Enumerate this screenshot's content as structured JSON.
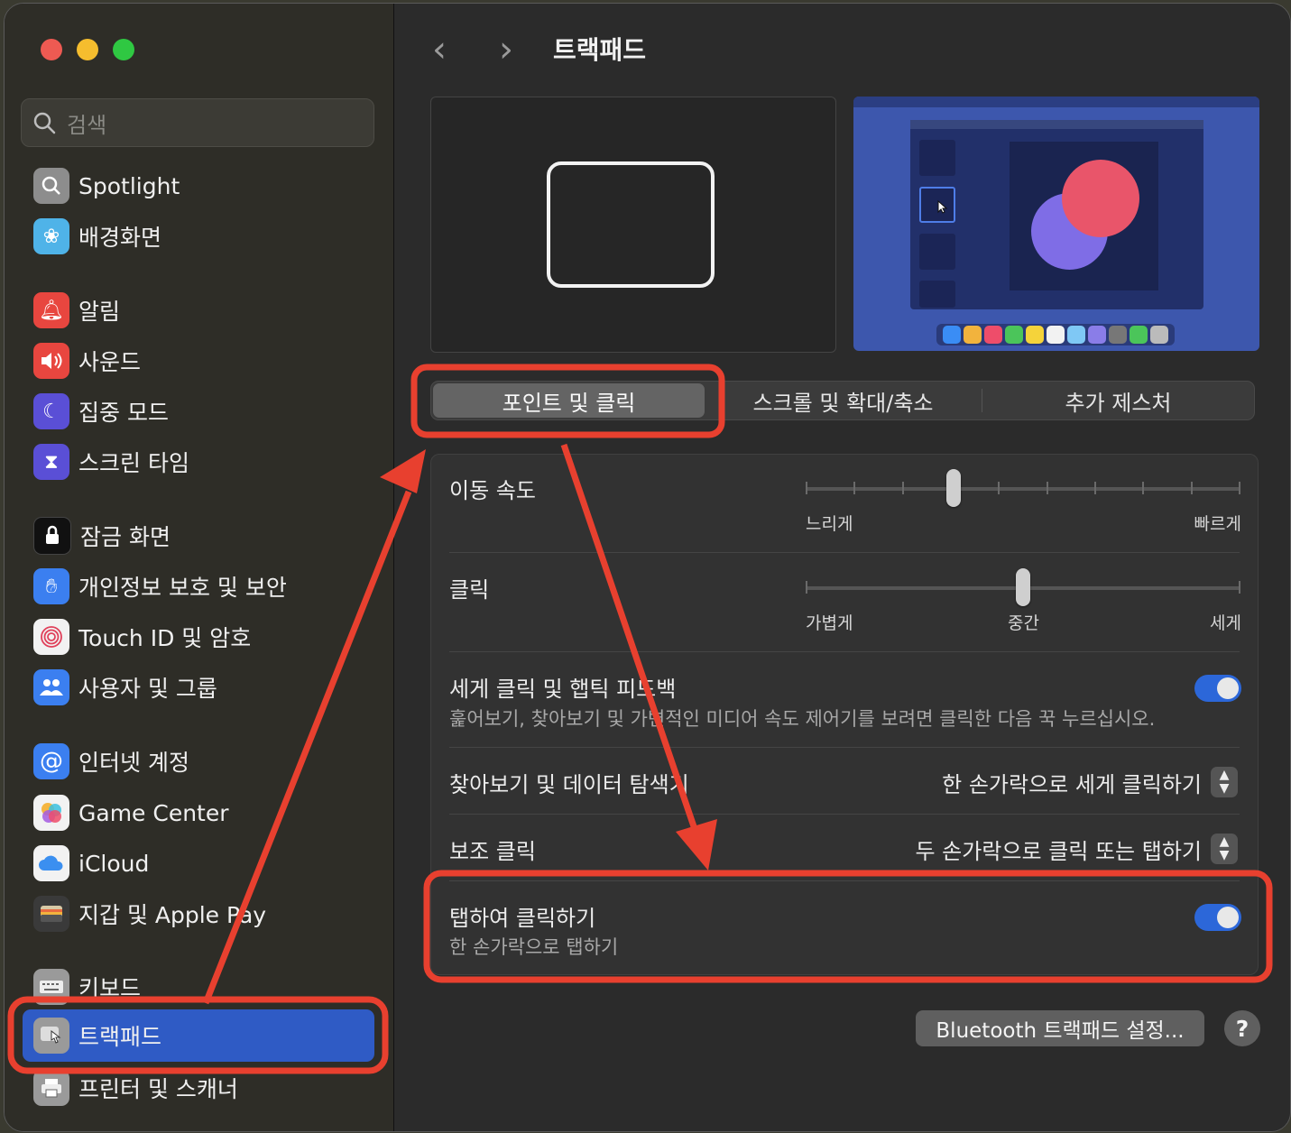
{
  "window": {
    "title": "트랙패드"
  },
  "search": {
    "placeholder": "검색"
  },
  "sidebar": {
    "items": [
      {
        "label": "Spotlight",
        "icon": "spotlight-icon",
        "color": "#8d8d8d"
      },
      {
        "label": "배경화면",
        "icon": "wallpaper-icon",
        "color": "#4fb3e8"
      },
      {
        "label": "알림",
        "icon": "bell-icon",
        "color": "#e8463f"
      },
      {
        "label": "사운드",
        "icon": "speaker-icon",
        "color": "#e8463f"
      },
      {
        "label": "집중 모드",
        "icon": "moon-icon",
        "color": "#5a4fd6"
      },
      {
        "label": "스크린 타임",
        "icon": "hourglass-icon",
        "color": "#5a4fd6"
      },
      {
        "label": "잠금 화면",
        "icon": "lock-icon",
        "color": "#1c1c1c"
      },
      {
        "label": "개인정보 보호 및 보안",
        "icon": "hand-icon",
        "color": "#3b7ff0"
      },
      {
        "label": "Touch ID 및 암호",
        "icon": "fingerprint-icon",
        "color": "#f2f2f2"
      },
      {
        "label": "사용자 및 그룹",
        "icon": "users-icon",
        "color": "#3b7ff0"
      },
      {
        "label": "인터넷 계정",
        "icon": "at-icon",
        "color": "#3b7ff0"
      },
      {
        "label": "Game Center",
        "icon": "game-center-icon",
        "color": "#f2f2f2"
      },
      {
        "label": "iCloud",
        "icon": "cloud-icon",
        "color": "#f2f2f2"
      },
      {
        "label": "지갑 및 Apple Pay",
        "icon": "wallet-icon",
        "color": "#3a3a3a"
      },
      {
        "label": "키보드",
        "icon": "keyboard-icon",
        "color": "#9a9a9a"
      },
      {
        "label": "트랙패드",
        "icon": "trackpad-icon",
        "color": "#9a9a9a",
        "selected": true
      },
      {
        "label": "프린터 및 스캐너",
        "icon": "printer-icon",
        "color": "#9a9a9a"
      }
    ]
  },
  "tabs": {
    "point_click": "포인트 및 클릭",
    "scroll_zoom": "스크롤 및 확대/축소",
    "more_gestures": "추가 제스처",
    "active": "포인트 및 클릭"
  },
  "settings": {
    "tracking_speed": {
      "label": "이동 속도",
      "min_label": "느리게",
      "max_label": "빠르게",
      "value_fraction": 0.34
    },
    "click": {
      "label": "클릭",
      "min_label": "가볍게",
      "mid_label": "중간",
      "max_label": "세게",
      "value_fraction": 0.5
    },
    "force_click": {
      "label": "세게 클릭 및 햅틱 피드백",
      "description": "훑어보기, 찾아보기 및 가변적인 미디어 속도 제어기를 보려면 클릭한 다음 꾹 누르십시오.",
      "enabled": true
    },
    "lookup": {
      "label": "찾아보기 및 데이터 탐색기",
      "value": "한 손가락으로 세게 클릭하기"
    },
    "secondary_click": {
      "label": "보조 클릭",
      "value": "두 손가락으로 클릭 또는 탭하기"
    },
    "tap_to_click": {
      "label": "탭하여 클릭하기",
      "description": "한 손가락으로 탭하기",
      "enabled": true
    }
  },
  "footer": {
    "bluetooth_button": "Bluetooth 트랙패드 설정...",
    "help": "?"
  },
  "colors": {
    "accent": "#2c67d9",
    "annotation": "#e8402f",
    "selected_sidebar": "#2f5bc5"
  }
}
